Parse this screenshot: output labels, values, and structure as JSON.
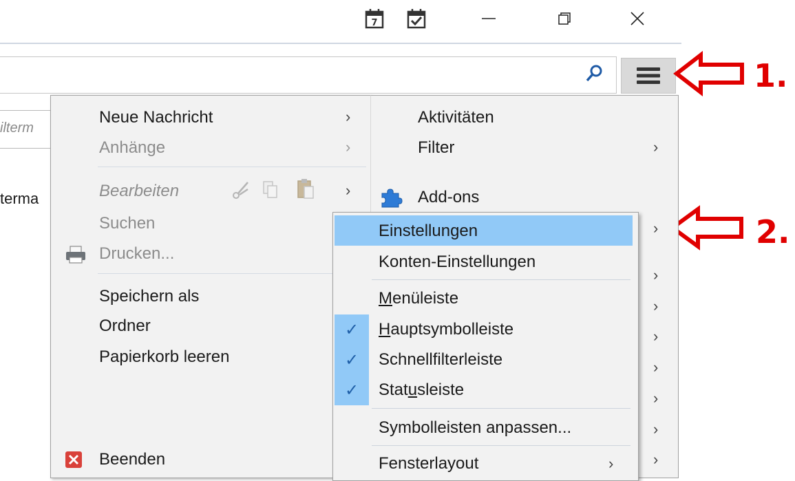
{
  "background": {
    "filter_placeholder": "ilterm",
    "list_text": "terma"
  },
  "main_menu": {
    "items": [
      {
        "label": "Neue Nachricht",
        "enabled": true,
        "submenu": true
      },
      {
        "label": "Anhänge",
        "enabled": false,
        "submenu": true
      },
      {
        "label": "Bearbeiten",
        "enabled": false,
        "submenu": true
      },
      {
        "label": "Suchen",
        "enabled": false
      },
      {
        "label": "Drucken...",
        "enabled": false
      },
      {
        "label": "Speichern als",
        "enabled": true
      },
      {
        "label": "Ordner",
        "enabled": true
      },
      {
        "label": "Papierkorb leeren",
        "enabled": true
      },
      {
        "label": "Beenden",
        "enabled": true
      }
    ]
  },
  "right_pane": {
    "items": [
      {
        "label": "Aktivitäten"
      },
      {
        "label": "Filter",
        "submenu": true
      },
      {
        "label": "Add-ons"
      }
    ]
  },
  "submenu": {
    "items": [
      {
        "label": "Einstellungen",
        "highlighted": true
      },
      {
        "label": "Konten-Einstellungen"
      },
      {
        "prefix": "",
        "accel": "M",
        "rest": "enüleiste",
        "checked": false
      },
      {
        "prefix": "",
        "accel": "H",
        "rest": "auptsymbolleiste",
        "checked": true
      },
      {
        "label": "Schnellfilterleiste",
        "checked": true
      },
      {
        "prefix": "Stat",
        "accel": "u",
        "rest": "sleiste",
        "checked": true
      },
      {
        "label": "Symbolleisten anpassen..."
      },
      {
        "label": "Fensterlayout",
        "submenu": true
      }
    ]
  },
  "annotations": {
    "step1": "1.",
    "step2": "2."
  },
  "colors": {
    "highlight": "#91c9f7",
    "annotation": "#e00000",
    "menu_bg": "#f2f2f2"
  }
}
